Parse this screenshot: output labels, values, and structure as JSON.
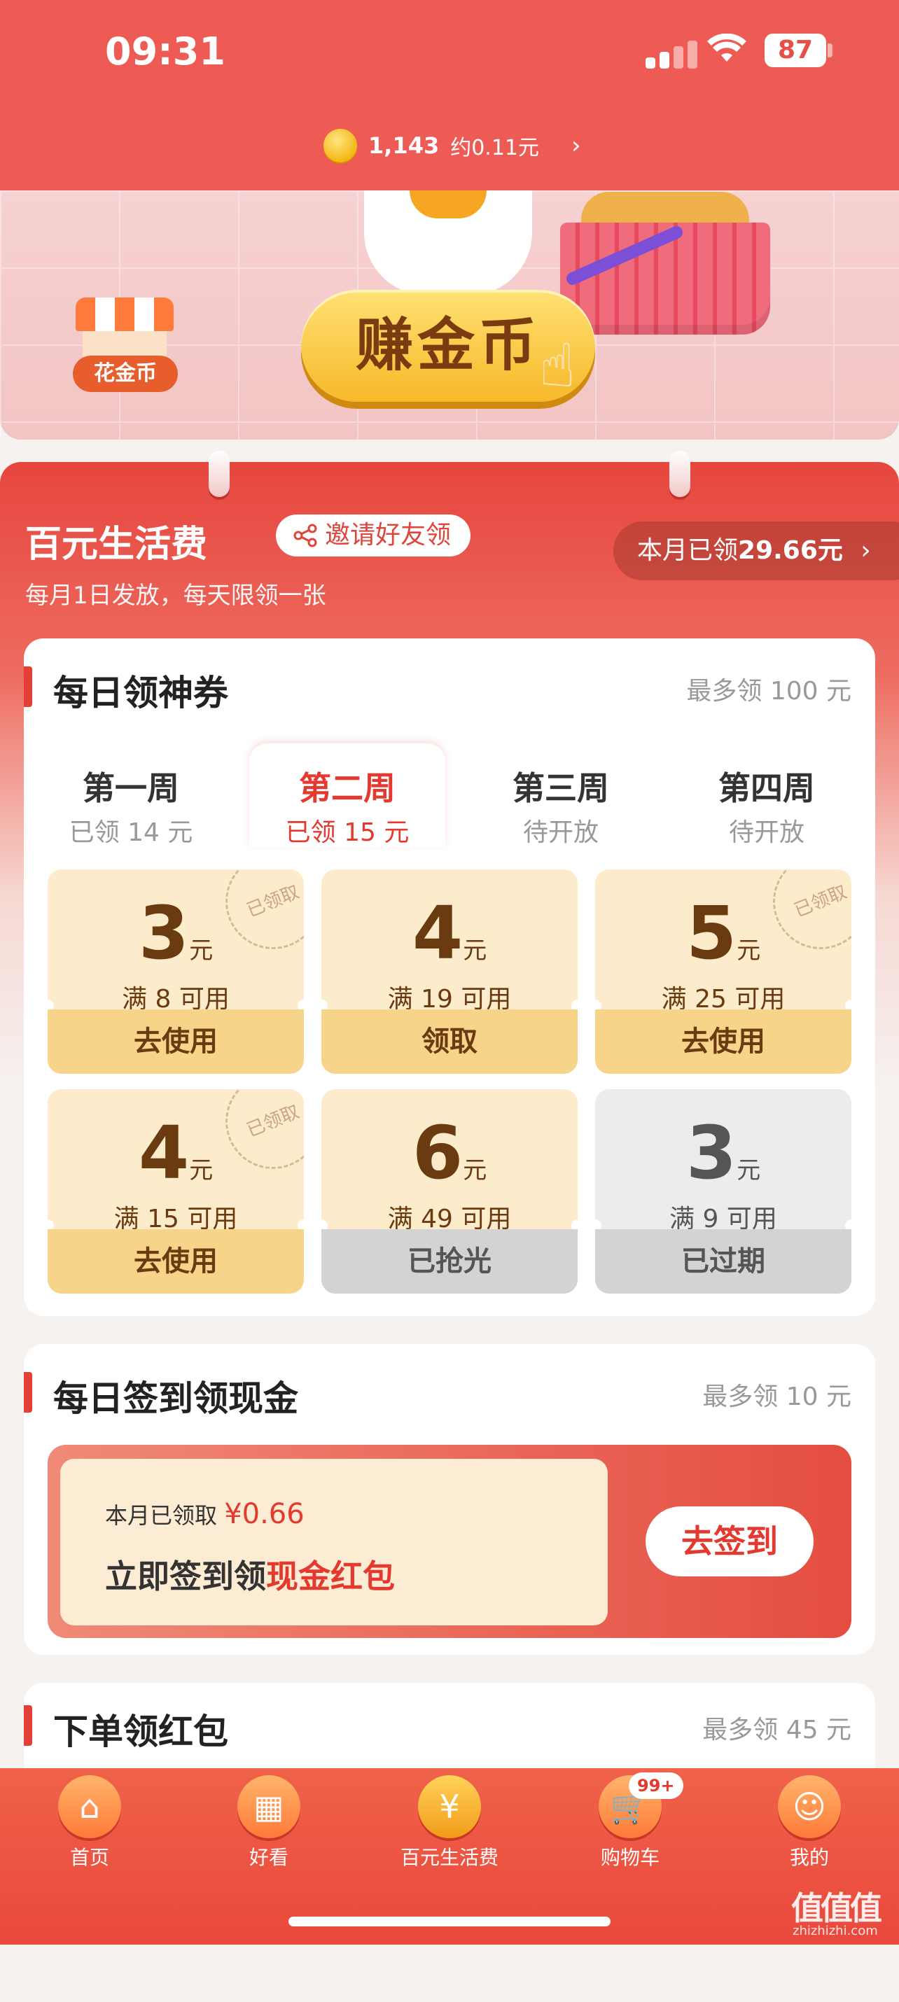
{
  "status_bar": {
    "time": "09:31",
    "battery": "87"
  },
  "coins": {
    "amount": "1,143",
    "approx": "约0.11元"
  },
  "banner": {
    "store_label": "花金币",
    "earn_button": "赚金币"
  },
  "header": {
    "title": "百元生活费",
    "invite_label": "邀请好友领",
    "subtitle": "每月1日发放，每天限领一张",
    "month_prefix": "本月已领",
    "month_amount": "29.66元"
  },
  "daily_coupons": {
    "title": "每日领神券",
    "max": "最多领 100 元",
    "weeks": [
      {
        "name": "第一周",
        "status": "已领 14 元"
      },
      {
        "name": "第二周",
        "status": "已领 15 元"
      },
      {
        "name": "第三周",
        "status": "待开放"
      },
      {
        "name": "第四周",
        "status": "待开放"
      }
    ],
    "coupons": [
      {
        "amount": "3",
        "unit": "元",
        "condition": "满 8 可用",
        "action": "去使用",
        "stamp": "已领取"
      },
      {
        "amount": "4",
        "unit": "元",
        "condition": "满 19 可用",
        "action": "领取",
        "stamp": ""
      },
      {
        "amount": "5",
        "unit": "元",
        "condition": "满 25 可用",
        "action": "去使用",
        "stamp": "已领取"
      },
      {
        "amount": "4",
        "unit": "元",
        "condition": "满 15 可用",
        "action": "去使用",
        "stamp": "已领取"
      },
      {
        "amount": "6",
        "unit": "元",
        "condition": "满 49 可用",
        "action": "已抢光",
        "stamp": ""
      },
      {
        "amount": "3",
        "unit": "元",
        "condition": "满 9 可用",
        "action": "已过期",
        "stamp": ""
      }
    ]
  },
  "checkin": {
    "title": "每日签到领现金",
    "max": "最多领 10 元",
    "received_label": "本月已领取",
    "received_amount": "¥0.66",
    "prompt_prefix": "立即签到领",
    "prompt_highlight": "现金红包",
    "button": "去签到"
  },
  "order_section": {
    "title": "下单领红包",
    "max": "最多领 45 元"
  },
  "tabbar": {
    "items": [
      {
        "label": "首页",
        "icon": "home-icon"
      },
      {
        "label": "好看",
        "icon": "grid-icon"
      },
      {
        "label": "百元生活费",
        "icon": "yuan-coin-icon"
      },
      {
        "label": "购物车",
        "icon": "cart-icon"
      },
      {
        "label": "我的",
        "icon": "profile-icon"
      }
    ],
    "cart_badge": "99+"
  },
  "watermark": {
    "main": "值值值",
    "sub": "zhizhizhi.com"
  },
  "colors": {
    "brand_red": "#e3392f",
    "coupon_bg": "#fdeccb",
    "coupon_action": "#f6d48a"
  }
}
